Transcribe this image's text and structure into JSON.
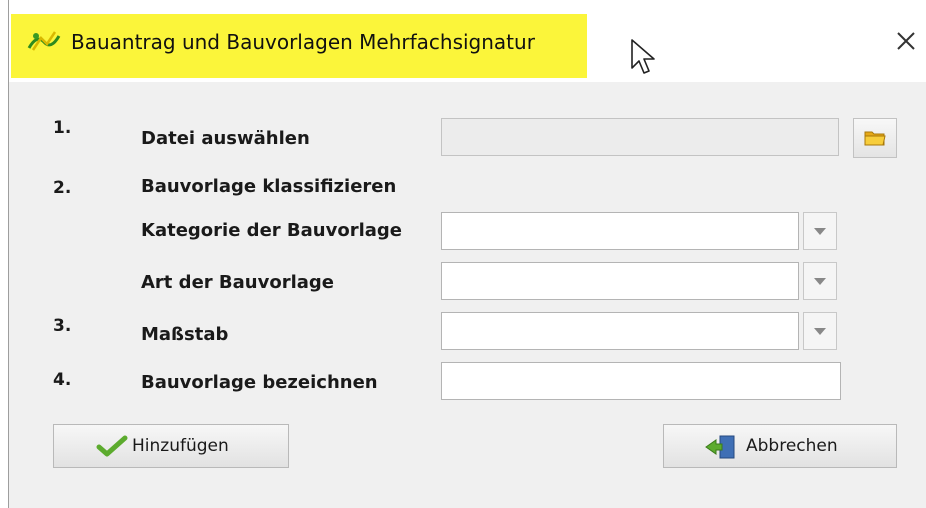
{
  "window": {
    "title": "Bauantrag und Bauvorlagen Mehrfachsignatur",
    "highlight_color": "#fbf53a"
  },
  "icons": {
    "app": "signature-app-icon",
    "cursor": "mouse-pointer-icon",
    "close": "close-icon",
    "folder": "folder-icon",
    "dropdown": "chevron-down-icon",
    "add": "checkmark-icon",
    "cancel": "exit-door-icon"
  },
  "form": {
    "step1": {
      "number": "1.",
      "label": "Datei auswählen",
      "value": ""
    },
    "step2": {
      "number": "2.",
      "label": "Bauvorlage klassifizieren"
    },
    "kategorie": {
      "label": "Kategorie der Bauvorlage",
      "value": ""
    },
    "art": {
      "label": "Art der Bauvorlage",
      "value": ""
    },
    "step3": {
      "number": "3.",
      "label": "Maßstab",
      "value": ""
    },
    "step4": {
      "number": "4.",
      "label": "Bauvorlage bezeichnen",
      "value": ""
    }
  },
  "buttons": {
    "add_label": "Hinzufügen",
    "cancel_label": "Abbrechen"
  }
}
